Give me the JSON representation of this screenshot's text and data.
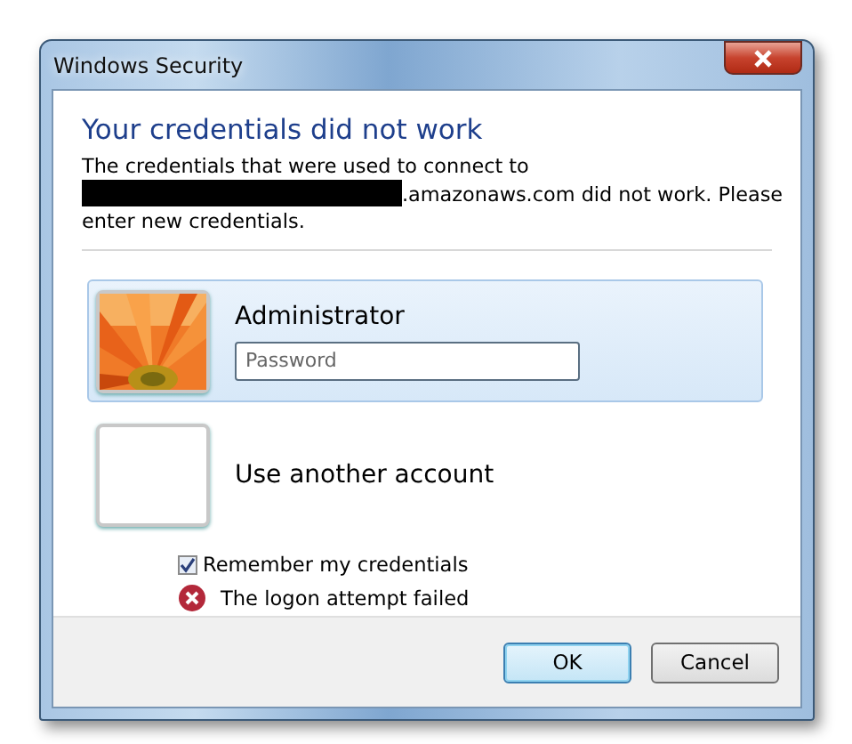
{
  "window": {
    "title": "Windows Security"
  },
  "heading": "Your credentials did not work",
  "message": {
    "before": "The credentials that were used to connect to",
    "redacted": true,
    "after": ".amazonaws.com did not work. Please enter new credentials."
  },
  "accounts": [
    {
      "kind": "user",
      "name": "Administrator",
      "selected": true,
      "password": {
        "placeholder": "Password"
      }
    },
    {
      "kind": "other",
      "name": "Use another account",
      "selected": false
    }
  ],
  "remember": {
    "label": "Remember my credentials",
    "checked": true
  },
  "error": "The logon attempt failed",
  "buttons": [
    {
      "label": "OK",
      "default": true
    },
    {
      "label": "Cancel",
      "default": false
    }
  ]
}
